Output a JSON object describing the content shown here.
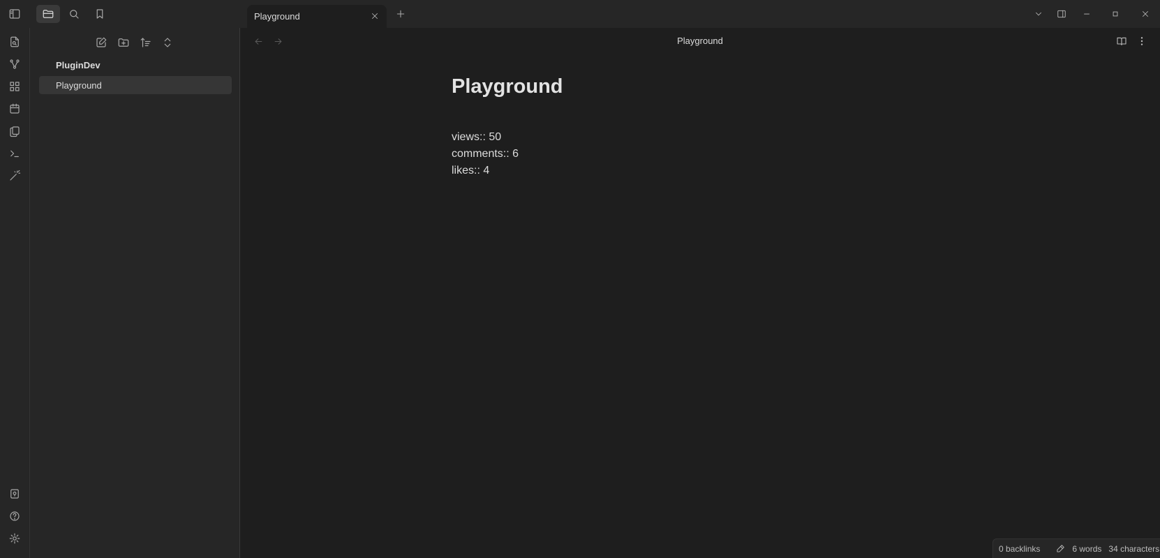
{
  "titlebar": {
    "left_icons": [
      "sidebar-toggle-icon",
      "folder-icon",
      "search-icon",
      "bookmark-icon"
    ],
    "tab": {
      "label": "Playground"
    },
    "window_controls": [
      "chevron-down-icon",
      "right-sidebar-icon",
      "minimize-icon",
      "maximize-icon",
      "close-icon"
    ]
  },
  "ribbon": {
    "top_icons": [
      "quick-switch-icon",
      "graph-icon",
      "canvas-icon",
      "calendar-icon",
      "templates-icon",
      "terminal-icon",
      "magic-wand-icon"
    ],
    "bottom_icons": [
      "vault-icon",
      "help-icon",
      "settings-icon"
    ]
  },
  "sidebar": {
    "actions": [
      "new-note-icon",
      "new-folder-icon",
      "sort-icon",
      "collapse-icon"
    ],
    "tree": {
      "folder": "PluginDev",
      "file": "Playground"
    }
  },
  "editor": {
    "header_title": "Playground",
    "title": "Playground",
    "lines": [
      "views:: 50",
      "comments:: 6",
      "likes:: 4"
    ]
  },
  "statusbar": {
    "backlinks": "0 backlinks",
    "words": "6 words",
    "characters": "34 characters"
  }
}
